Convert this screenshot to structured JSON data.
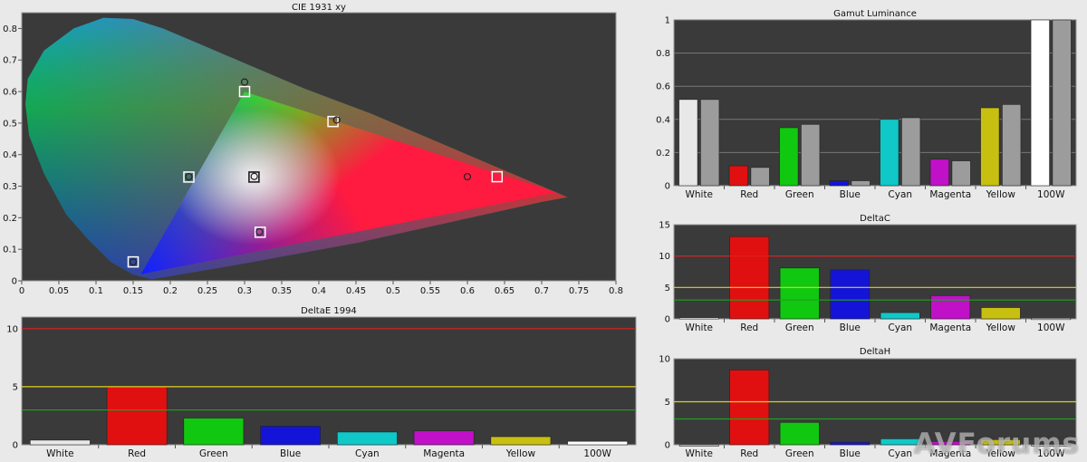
{
  "watermark": "AVForums",
  "chart_data": [
    {
      "type": "scatter",
      "title": "CIE 1931 xy",
      "xlabel": "",
      "ylabel": "",
      "xlim": [
        0,
        0.8
      ],
      "ylim": [
        0,
        0.85
      ],
      "xticks": [
        "0",
        "0.05",
        "0.1",
        "0.15",
        "0.2",
        "0.25",
        "0.3",
        "0.35",
        "0.4",
        "0.45",
        "0.5",
        "0.55",
        "0.6",
        "0.65",
        "0.7",
        "0.75",
        "0.8"
      ],
      "yticks": [
        "0",
        "0.1",
        "0.2",
        "0.3",
        "0.4",
        "0.5",
        "0.6",
        "0.7",
        "0.8"
      ],
      "series": [
        {
          "name": "",
          "marker": "square",
          "points": [
            {
              "label": "Red",
              "x": 0.64,
              "y": 0.33
            },
            {
              "label": "Green",
              "x": 0.3,
              "y": 0.6
            },
            {
              "label": "Blue",
              "x": 0.15,
              "y": 0.06
            },
            {
              "label": "Cyan",
              "x": 0.225,
              "y": 0.329
            },
            {
              "label": "Magenta",
              "x": 0.321,
              "y": 0.154
            },
            {
              "label": "Yellow",
              "x": 0.419,
              "y": 0.505
            },
            {
              "label": "White",
              "x": 0.3127,
              "y": 0.329
            }
          ]
        },
        {
          "name": "",
          "marker": "circle",
          "points": [
            {
              "label": "Red",
              "x": 0.6,
              "y": 0.33
            },
            {
              "label": "Green",
              "x": 0.3,
              "y": 0.63
            },
            {
              "label": "Blue",
              "x": 0.15,
              "y": 0.06
            },
            {
              "label": "Cyan",
              "x": 0.225,
              "y": 0.33
            },
            {
              "label": "Magenta",
              "x": 0.32,
              "y": 0.155
            },
            {
              "label": "Yellow",
              "x": 0.424,
              "y": 0.51
            },
            {
              "label": "White",
              "x": 0.313,
              "y": 0.331
            }
          ]
        }
      ],
      "gamut_triangle": [
        [
          0.72,
          0.28
        ],
        [
          0.3,
          0.6
        ],
        [
          0.16,
          0.02
        ]
      ],
      "grid": false,
      "legend": "none"
    },
    {
      "type": "bar",
      "title": "Gamut Luminance",
      "categories": [
        "White",
        "Red",
        "Green",
        "Blue",
        "Cyan",
        "Magenta",
        "Yellow",
        "100W"
      ],
      "colors": [
        "#e8e8e8",
        "#e01010",
        "#10c810",
        "#1414d8",
        "#10c8c8",
        "#c010c8",
        "#c8c010",
        "#ffffff"
      ],
      "series": [
        {
          "name": "",
          "values": [
            0.52,
            0.12,
            0.35,
            0.03,
            0.4,
            0.16,
            0.47,
            1.0
          ]
        },
        {
          "name": "",
          "values": [
            0.52,
            0.11,
            0.37,
            0.03,
            0.41,
            0.15,
            0.49,
            1.0
          ]
        }
      ],
      "ylim": [
        0,
        1.0
      ],
      "yticks": [
        "0",
        "0.2",
        "0.4",
        "0.6",
        "0.8",
        "1"
      ],
      "grid": true,
      "legend": "none"
    },
    {
      "type": "bar",
      "title": "DeltaE 1994",
      "categories": [
        "White",
        "Red",
        "Green",
        "Blue",
        "Cyan",
        "Magenta",
        "Yellow",
        "100W"
      ],
      "colors": [
        "#e8e8e8",
        "#e01010",
        "#10c810",
        "#1414d8",
        "#10c8c8",
        "#c010c8",
        "#c8c010",
        "#ffffff"
      ],
      "values": [
        0.4,
        5.0,
        2.3,
        1.6,
        1.1,
        1.2,
        0.7,
        0.3
      ],
      "ylim": [
        0,
        11
      ],
      "yticks": [
        "0",
        "5",
        "10"
      ],
      "thresholds": [
        {
          "value": 10,
          "color": "#e02020"
        },
        {
          "value": 5,
          "color": "#e0d020"
        },
        {
          "value": 3,
          "color": "#20a020"
        }
      ],
      "grid": false,
      "legend": "none"
    },
    {
      "type": "bar",
      "title": "DeltaC",
      "categories": [
        "White",
        "Red",
        "Green",
        "Blue",
        "Cyan",
        "Magenta",
        "Yellow",
        "100W"
      ],
      "colors": [
        "#e8e8e8",
        "#e01010",
        "#10c810",
        "#1414d8",
        "#10c8c8",
        "#c010c8",
        "#c8c010",
        "#ffffff"
      ],
      "values": [
        0.2,
        13.1,
        8.1,
        7.8,
        1.0,
        3.7,
        1.8,
        0.1
      ],
      "ylim": [
        0,
        15
      ],
      "yticks": [
        "0",
        "5",
        "10",
        "15"
      ],
      "thresholds": [
        {
          "value": 10,
          "color": "#e02020"
        },
        {
          "value": 5,
          "color": "#e0d020"
        },
        {
          "value": 3,
          "color": "#20a020"
        }
      ],
      "grid": false,
      "legend": "none"
    },
    {
      "type": "bar",
      "title": "DeltaH",
      "categories": [
        "White",
        "Red",
        "Green",
        "Blue",
        "Cyan",
        "Magenta",
        "Yellow",
        "100W"
      ],
      "colors": [
        "#e8e8e8",
        "#e01010",
        "#10c810",
        "#1414d8",
        "#10c8c8",
        "#c010c8",
        "#c8c010",
        "#ffffff"
      ],
      "values": [
        0.0,
        8.7,
        2.6,
        0.3,
        0.7,
        0.4,
        0.6,
        0.0
      ],
      "ylim": [
        0,
        10
      ],
      "yticks": [
        "0",
        "5",
        "10"
      ],
      "thresholds": [
        {
          "value": 5,
          "color": "#e0d020"
        },
        {
          "value": 3,
          "color": "#20a020"
        }
      ],
      "grid": false,
      "legend": "none"
    }
  ]
}
